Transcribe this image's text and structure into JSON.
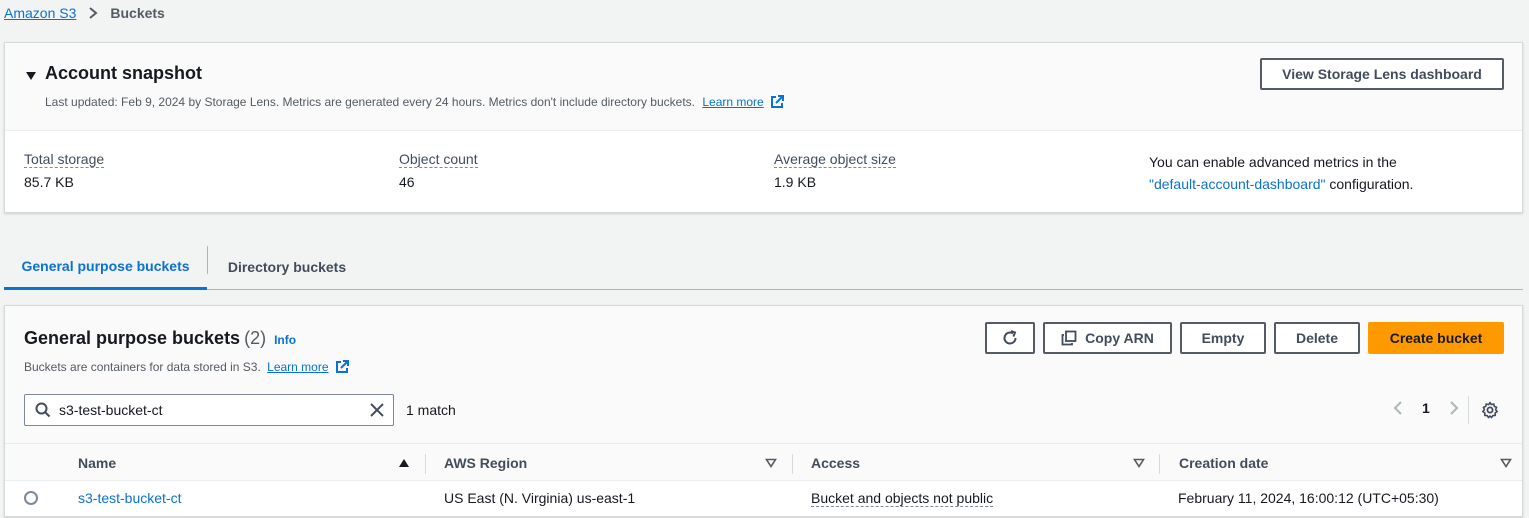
{
  "breadcrumb": {
    "root": "Amazon S3",
    "current": "Buckets"
  },
  "snapshot": {
    "title": "Account snapshot",
    "subtitle": "Last updated: Feb 9, 2024 by Storage Lens. Metrics are generated every 24 hours. Metrics don't include directory buckets.",
    "learn_more": "Learn more",
    "lens_button": "View Storage Lens dashboard",
    "metrics": [
      {
        "label": "Total storage",
        "value": "85.7 KB"
      },
      {
        "label": "Object count",
        "value": "46"
      },
      {
        "label": "Average object size",
        "value": "1.9 KB"
      }
    ],
    "advanced_prefix": "You can enable advanced metrics in the",
    "advanced_link": "\"default-account-dashboard\"",
    "advanced_suffix": " configuration."
  },
  "tabs": [
    {
      "label": "General purpose buckets",
      "active": true
    },
    {
      "label": "Directory buckets",
      "active": false
    }
  ],
  "buckets": {
    "title": "General purpose buckets",
    "count": "(2)",
    "info": "Info",
    "subtitle": "Buckets are containers for data stored in S3.",
    "learn_more": "Learn more",
    "buttons": {
      "copy_arn": "Copy ARN",
      "empty": "Empty",
      "delete": "Delete",
      "create": "Create bucket"
    },
    "search_value": "s3-test-bucket-ct",
    "match_text": "1 match",
    "page": "1",
    "columns": [
      "Name",
      "AWS Region",
      "Access",
      "Creation date"
    ],
    "rows": [
      {
        "name": "s3-test-bucket-ct",
        "region": "US East (N. Virginia) us-east-1",
        "access": "Bucket and objects not public",
        "created": "February 11, 2024, 16:00:12 (UTC+05:30)"
      }
    ]
  },
  "colors": {
    "link": "#0972d3",
    "primary_button": "#ff9900",
    "background": "#f2f3f3"
  },
  "icons": [
    "chevron-right-icon",
    "caret-down-icon",
    "external-link-icon",
    "refresh-icon",
    "copy-icon",
    "search-icon",
    "clear-icon",
    "chevron-left-icon",
    "settings-gear-icon",
    "sort-asc-icon",
    "sort-desc-icon"
  ]
}
